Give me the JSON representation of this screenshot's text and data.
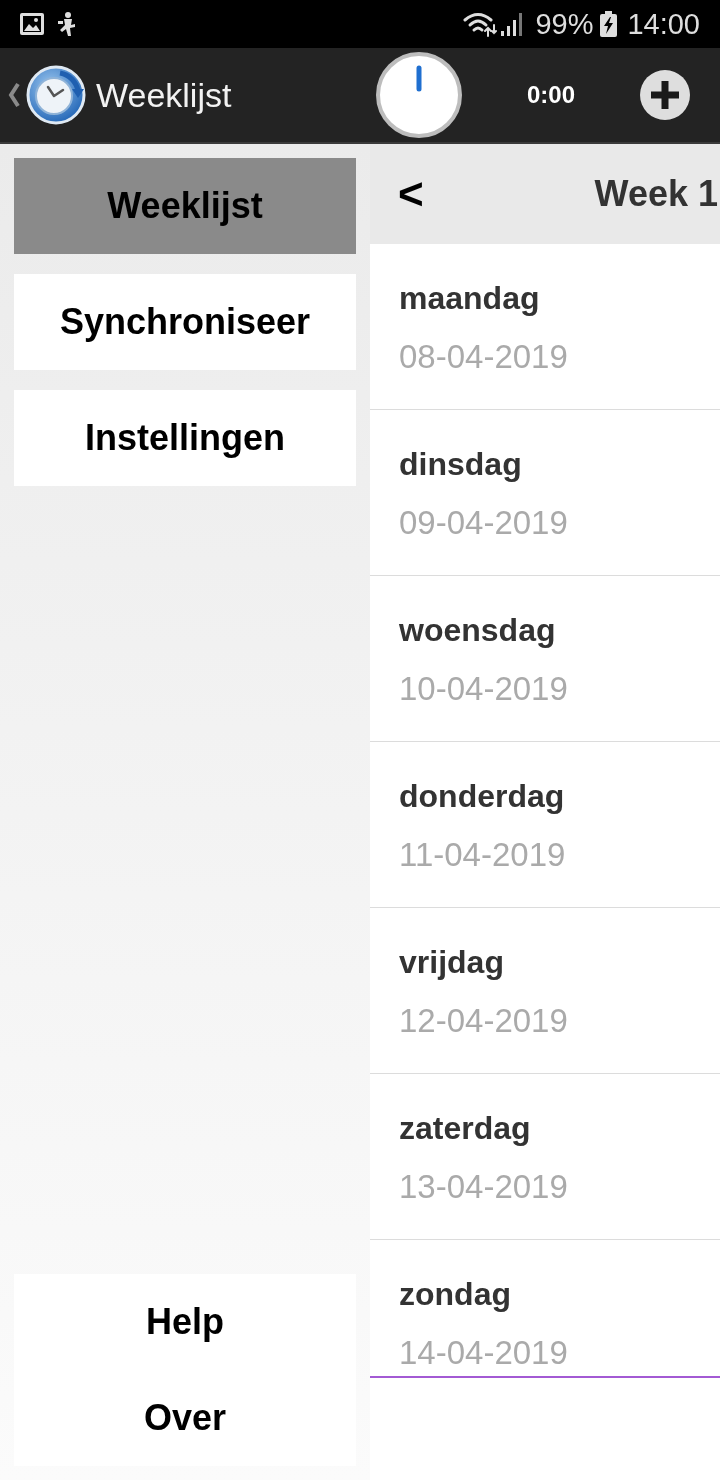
{
  "status_bar": {
    "battery": "99%",
    "time": "14:00"
  },
  "app_bar": {
    "title": "Weeklijst",
    "timer": "0:00"
  },
  "sidebar": {
    "items": [
      {
        "label": "Weeklijst",
        "selected": true
      },
      {
        "label": "Synchroniseer",
        "selected": false
      },
      {
        "label": "Instellingen",
        "selected": false
      }
    ],
    "footer_items": [
      {
        "label": "Help"
      },
      {
        "label": "Over"
      }
    ]
  },
  "week_panel": {
    "prev_button": "<",
    "title": "Week 1",
    "days": [
      {
        "name": "maandag",
        "date": "08-04-2019"
      },
      {
        "name": "dinsdag",
        "date": "09-04-2019"
      },
      {
        "name": "woensdag",
        "date": "10-04-2019"
      },
      {
        "name": "donderdag",
        "date": "11-04-2019"
      },
      {
        "name": "vrijdag",
        "date": "12-04-2019"
      },
      {
        "name": "zaterdag",
        "date": "13-04-2019"
      },
      {
        "name": "zondag",
        "date": "14-04-2019"
      }
    ]
  }
}
